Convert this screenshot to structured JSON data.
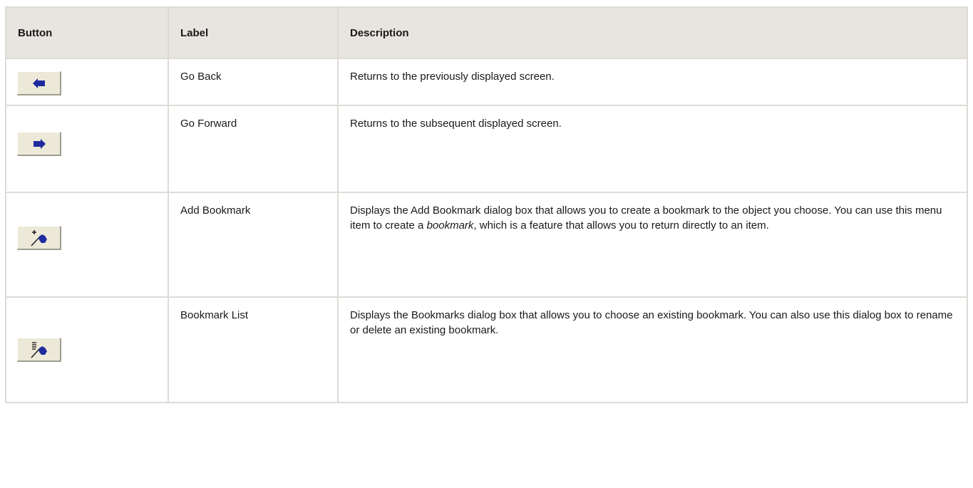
{
  "table": {
    "headers": {
      "button": "Button",
      "label": "Label",
      "description": "Description"
    },
    "rows": [
      {
        "icon": "arrow-left-icon",
        "label": "Go Back",
        "description": "Returns to the previously displayed screen."
      },
      {
        "icon": "arrow-right-icon",
        "label": "Go Forward",
        "description": "Returns to the subsequent displayed screen."
      },
      {
        "icon": "add-bookmark-icon",
        "label": "Add Bookmark",
        "description_before": "Displays the Add Bookmark dialog box that allows you to create a bookmark to the object you choose. You can use this menu item to create a ",
        "description_emphasis": "bookmark",
        "description_after": ", which is a feature that allows you to return directly to an item."
      },
      {
        "icon": "bookmark-list-icon",
        "label": "Bookmark List",
        "description": "Displays the Bookmarks dialog box that allows you to choose an existing bookmark. You can also use this dialog box to rename or delete an existing bookmark."
      }
    ]
  },
  "colors": {
    "header_bg": "#e8e4df",
    "border": "#dedbd6",
    "button_face": "#ece9d8",
    "icon_blue": "#1e2a9e"
  }
}
